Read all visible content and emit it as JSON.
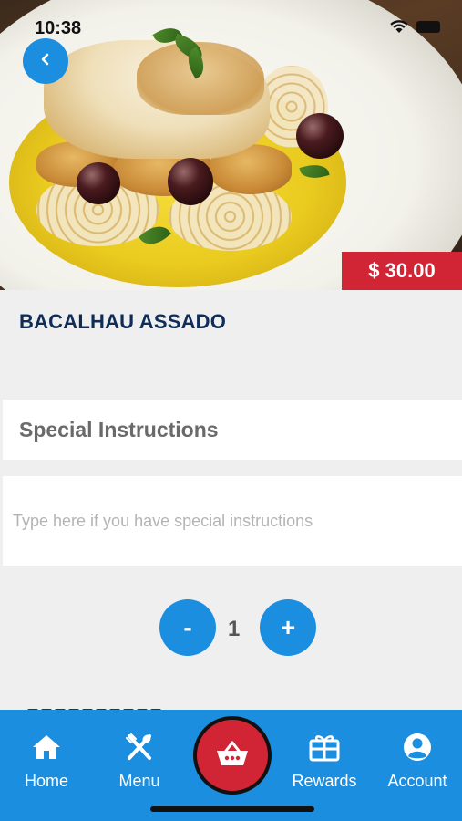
{
  "status_bar": {
    "time": "10:38"
  },
  "product": {
    "name": "BACALHAU ASSADO",
    "price": "$ 30.00"
  },
  "instructions": {
    "heading": "Special Instructions",
    "value": "",
    "placeholder": "Type here if you have special instructions"
  },
  "quantity": {
    "minus_label": "-",
    "value": "1",
    "plus_label": "+"
  },
  "tabbar": {
    "home": "Home",
    "menu": "Menu",
    "rewards": "Rewards",
    "account": "Account"
  },
  "colors": {
    "accent_blue": "#1b8ee0",
    "price_red": "#d12435",
    "title_navy": "#0f2d57",
    "background": "#efefef"
  },
  "icons": {
    "back": "chevron-left-icon",
    "home": "home-icon",
    "menu": "fork-knife-icon",
    "cart": "basket-icon",
    "rewards": "gift-card-icon",
    "account": "user-circle-icon"
  }
}
